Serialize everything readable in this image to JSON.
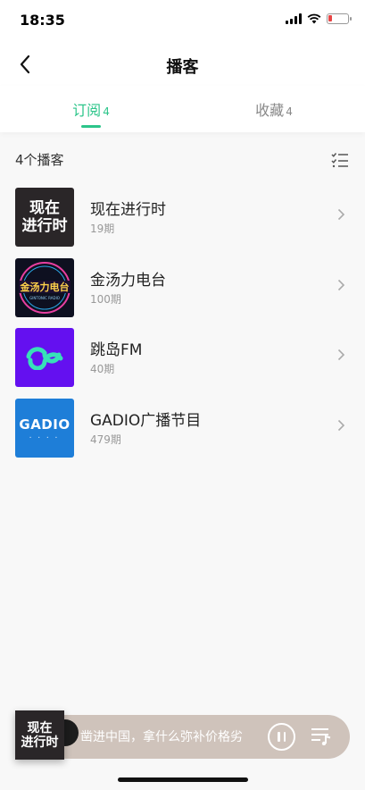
{
  "status": {
    "time": "18:35"
  },
  "nav": {
    "title": "播客"
  },
  "tabs": [
    {
      "label": "订阅",
      "count": "4",
      "active": true
    },
    {
      "label": "收藏",
      "count": "4",
      "active": false
    }
  ],
  "list": {
    "count_label": "4个播客",
    "items": [
      {
        "title": "现在进行时",
        "episodes": "19期",
        "cover_text": [
          "现在",
          "进行时"
        ]
      },
      {
        "title": "金汤力电台",
        "episodes": "100期",
        "cover_text": [
          "金汤力电台",
          "GINTONIC RADIO"
        ]
      },
      {
        "title": "跳岛FM",
        "episodes": "40期",
        "cover_text": []
      },
      {
        "title": "GADIO广播节目",
        "episodes": "479期",
        "cover_text": [
          "GADIO",
          "• • • •"
        ]
      }
    ]
  },
  "player": {
    "now_playing": "凿进中国，拿什么弥补价格劣",
    "cover_text": [
      "现在",
      "进行时"
    ]
  },
  "colors": {
    "accent": "#2cc58a",
    "player_bg": "#cfc3bb"
  }
}
